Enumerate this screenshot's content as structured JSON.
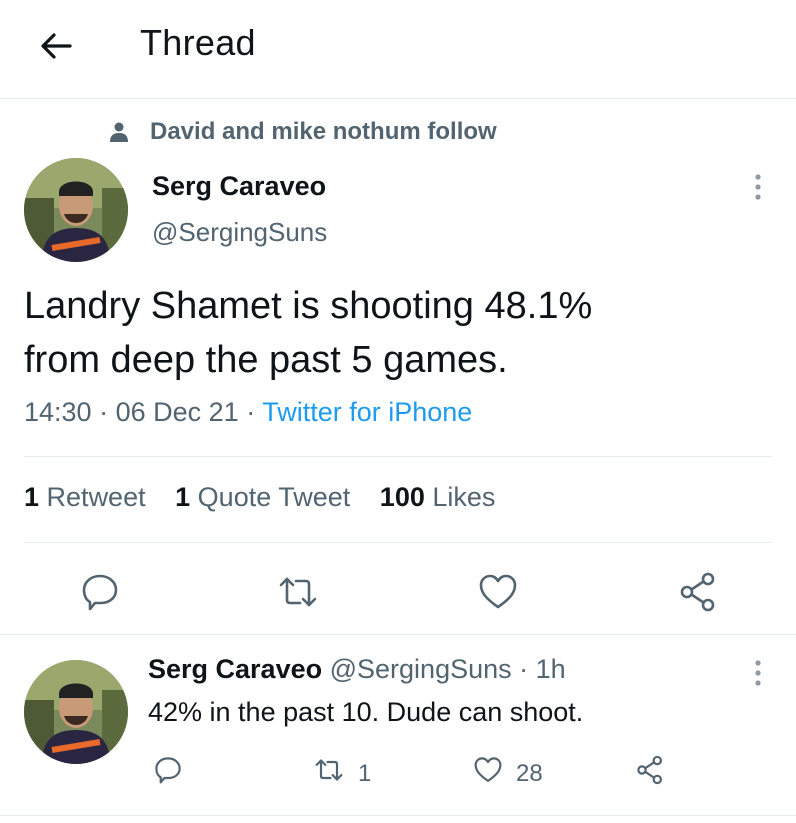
{
  "header": {
    "title": "Thread"
  },
  "social_context": {
    "text": "David and mike nothum follow"
  },
  "main_tweet": {
    "author_name": "Serg Caraveo",
    "author_handle": "@SergingSuns",
    "text_line1": "Landry Shamet is shooting 48.1%",
    "text_line2": "from deep the past 5 games.",
    "time": "14:30",
    "date": "06 Dec 21",
    "sep": "·",
    "source": "Twitter for iPhone",
    "stats": {
      "retweets_count": "1",
      "retweets_label": "Retweet",
      "quotes_count": "1",
      "quotes_label": "Quote Tweet",
      "likes_count": "100",
      "likes_label": "Likes"
    }
  },
  "reply": {
    "author_name": "Serg Caraveo",
    "author_handle": "@SergingSuns",
    "sep": "·",
    "time": "1h",
    "text": "42% in the past 10. Dude can shoot.",
    "retweets": "1",
    "likes": "28"
  },
  "icons": {
    "back": "arrow-left-icon",
    "person": "person-icon",
    "more": "more-vertical-icon",
    "reply": "reply-icon",
    "retweet": "retweet-icon",
    "like": "heart-icon",
    "share": "share-icon"
  },
  "colors": {
    "text": "#0f1419",
    "muted": "#536471",
    "accent": "#1d9bf0",
    "divider": "#e6ecf0"
  }
}
